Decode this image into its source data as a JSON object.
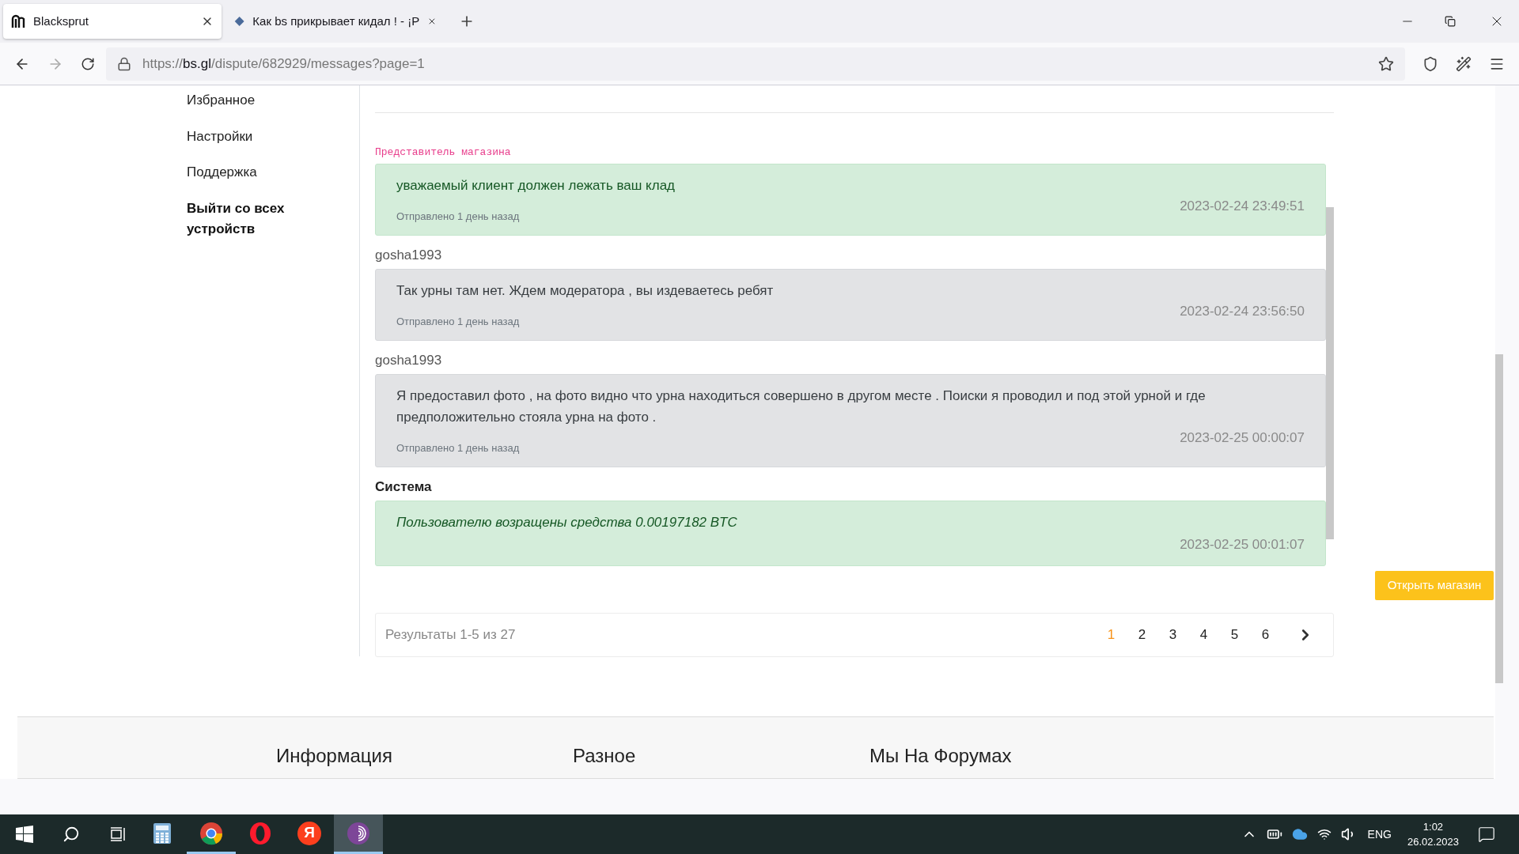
{
  "browser": {
    "tabs": [
      {
        "title": "Blacksprut",
        "selected": true,
        "kind": "blacksprut"
      },
      {
        "title": "Как bs прикрывает кидал ! - ¡P",
        "selected": false,
        "kind": "diamond"
      }
    ],
    "url_scheme": "https://",
    "url_host": "bs.gl",
    "url_path": "/dispute/682929/messages?page=1"
  },
  "sidebar": {
    "items": [
      {
        "label": "Избранное",
        "kind": "link"
      },
      {
        "label": "Настройки",
        "kind": "link"
      },
      {
        "label": "Поддержка",
        "kind": "link"
      },
      {
        "label": "Выйти со всех устройств",
        "kind": "logout"
      }
    ]
  },
  "messages": [
    {
      "kind": "shop",
      "author": "Представитель магазина",
      "text": "уважаемый клиент должен лежать ваш клад",
      "sent": "Отправлено 1 день назад",
      "time": "2023-02-24 23:49:51"
    },
    {
      "kind": "user",
      "author": "gosha1993",
      "text": "Так урны там нет. Ждем модератора , вы издеваетесь ребят",
      "sent": "Отправлено 1 день назад",
      "time": "2023-02-24 23:56:50"
    },
    {
      "kind": "user",
      "author": "gosha1993",
      "text": "Я предоставил фото , на фото видно что урна находиться совершено в другом месте . Поиски я проводил и под этой урной и где предположительно стояла урна на фото .",
      "sent": "Отправлено 1 день назад",
      "time": "2023-02-25 00:00:07"
    },
    {
      "kind": "system",
      "author": "Система",
      "text": "Пользователю возращены средства 0.00197182 BTC",
      "time": "2023-02-25 00:01:07"
    }
  ],
  "pagination": {
    "summary": "Результаты 1-5 из 27",
    "pages": [
      {
        "label": "1",
        "selected": true
      },
      {
        "label": "2",
        "selected": false
      },
      {
        "label": "3",
        "selected": false
      },
      {
        "label": "4",
        "selected": false
      },
      {
        "label": "5",
        "selected": false
      },
      {
        "label": "6",
        "selected": false
      }
    ]
  },
  "open_shop_button": "Открыть магазин",
  "footer": {
    "headings": [
      "Информация",
      "Разное",
      "Мы На Форумах"
    ]
  },
  "taskbar": {
    "apps": [
      {
        "kind": "calculator",
        "running": false,
        "selected": false
      },
      {
        "kind": "chrome",
        "running": true,
        "selected": false
      },
      {
        "kind": "opera",
        "running": false,
        "selected": false
      },
      {
        "kind": "yandex",
        "label": "Я",
        "running": false,
        "selected": false
      },
      {
        "kind": "tor",
        "running": true,
        "selected": true
      }
    ],
    "language": "ENG",
    "time": "1:02",
    "date": "26.02.2023"
  }
}
